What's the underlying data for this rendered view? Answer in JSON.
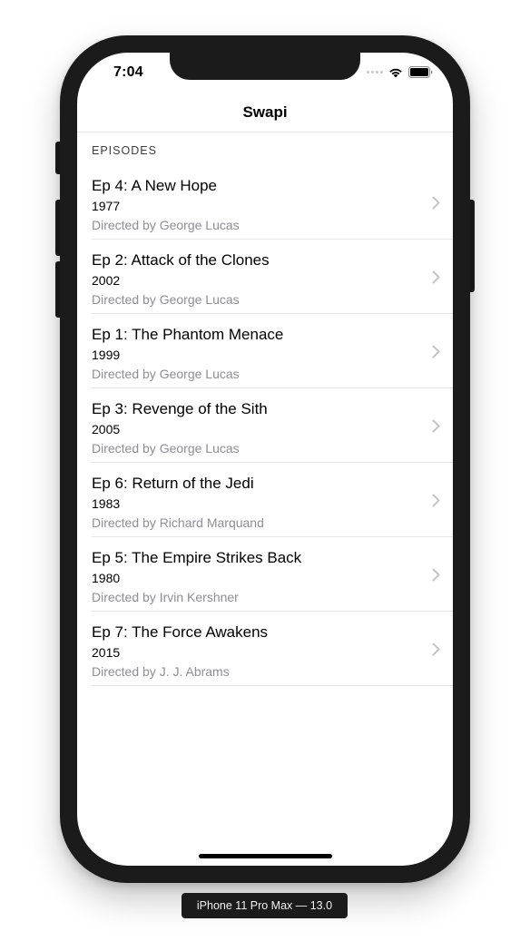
{
  "status_bar": {
    "time": "7:04"
  },
  "nav": {
    "title": "Swapi"
  },
  "section": {
    "header": "EPISODES"
  },
  "episodes": [
    {
      "title": "Ep 4: A New Hope",
      "year": "1977",
      "director": "Directed by George Lucas"
    },
    {
      "title": "Ep 2: Attack of the Clones",
      "year": "2002",
      "director": "Directed by George Lucas"
    },
    {
      "title": "Ep 1: The Phantom Menace",
      "year": "1999",
      "director": "Directed by George Lucas"
    },
    {
      "title": "Ep 3: Revenge of the Sith",
      "year": "2005",
      "director": "Directed by George Lucas"
    },
    {
      "title": "Ep 6: Return of the Jedi",
      "year": "1983",
      "director": "Directed by Richard Marquand"
    },
    {
      "title": "Ep 5: The Empire Strikes Back",
      "year": "1980",
      "director": "Directed by Irvin Kershner"
    },
    {
      "title": "Ep 7: The Force Awakens",
      "year": "2015",
      "director": "Directed by J. J. Abrams"
    }
  ],
  "device_label": "iPhone 11 Pro Max — 13.0",
  "colors": {
    "secondary_text": "#8e8e93",
    "chevron": "#c4c4c7",
    "device_frame": "#1b1b1b"
  },
  "icons": {
    "row_accessory": "chevron-right-icon",
    "signal": "cellular-signal-icon",
    "wifi": "wifi-icon",
    "battery": "battery-icon"
  }
}
